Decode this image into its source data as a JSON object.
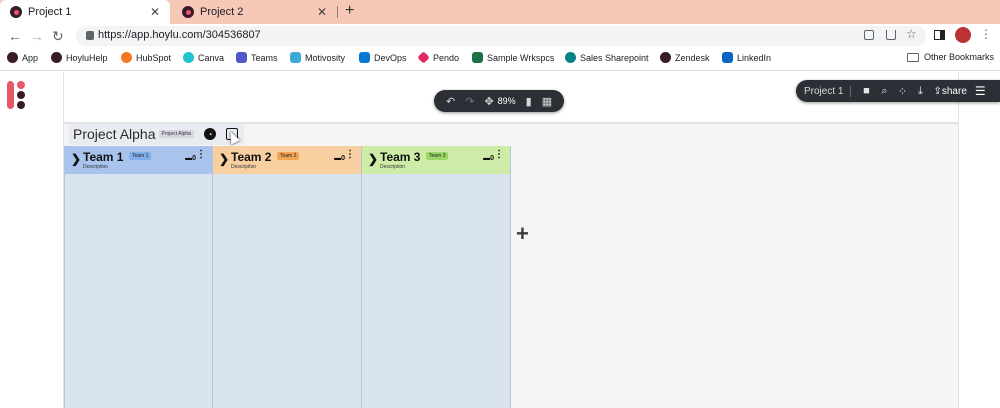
{
  "browser": {
    "tabs": [
      {
        "title": "Project 1",
        "active": true
      },
      {
        "title": "Project 2",
        "active": false
      }
    ],
    "tab_close": "✕",
    "new_tab": "+",
    "url": "https://app.hoylu.com/304536807",
    "nav": {
      "back": "←",
      "forward": "→",
      "reload": "↻"
    },
    "bookmarks": [
      {
        "label": "App",
        "color": "#3a1b2a"
      },
      {
        "label": "HoyluHelp",
        "color": "#3a1b2a"
      },
      {
        "label": "HubSpot",
        "color": "#f57722"
      },
      {
        "label": "Canva",
        "color": "#20c4cb"
      },
      {
        "label": "Teams",
        "color": "#5059c9"
      },
      {
        "label": "Motivosity",
        "color": "#3fa9d6"
      },
      {
        "label": "DevOps",
        "color": "#0078d4"
      },
      {
        "label": "Pendo",
        "color": "#e22a5f"
      },
      {
        "label": "Sample Wrkspcs",
        "color": "#1d7044"
      },
      {
        "label": "Sales Sharepoint",
        "color": "#038387"
      },
      {
        "label": "Zendesk",
        "color": "#3a1b2a"
      },
      {
        "label": "LinkedIn",
        "color": "#0a66c2"
      }
    ],
    "other_bookmarks": "Other Bookmarks"
  },
  "app": {
    "center_toolbar": {
      "undo": "↶",
      "redo": "↷",
      "move": "✥",
      "zoom": "89%",
      "bookmark": "▮",
      "grid": "▦"
    },
    "right_toolbar": {
      "title": "Project 1",
      "share": "share",
      "icons": [
        "video-icon",
        "search-icon",
        "apps-icon",
        "download-icon"
      ]
    },
    "board": {
      "title": "Project Alpha",
      "tag": "Project Alpha"
    },
    "columns": [
      {
        "name": "Team 1",
        "tag": "Team 1",
        "desc": "Description",
        "count": "0",
        "tag_color": "#7faee8",
        "head_color": "#a9c4ec"
      },
      {
        "name": "Team 2",
        "tag": "Team 2",
        "desc": "Description",
        "count": "0",
        "tag_color": "#f2a455",
        "head_color": "#f7cfa0"
      },
      {
        "name": "Team 3",
        "tag": "Team 3",
        "desc": "Description",
        "count": "0",
        "tag_color": "#9ad86a",
        "head_color": "#cdeca8"
      }
    ],
    "add_column": "+"
  }
}
